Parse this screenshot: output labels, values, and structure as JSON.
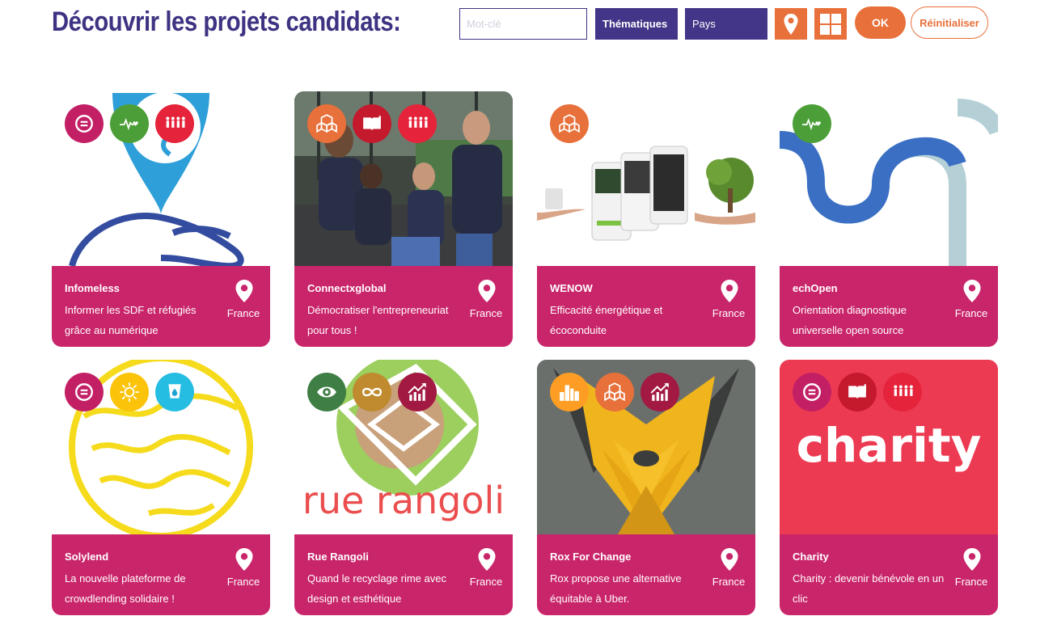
{
  "header": {
    "title": "Découvrir les projets candidats:",
    "search_placeholder": "Mot-clé",
    "themes_label": "Thématiques",
    "country_label": "Pays",
    "ok_label": "OK",
    "reset_label": "Réinitialiser"
  },
  "colors": {
    "brand_purple": "#3d3382",
    "accent_orange": "#e8703a",
    "card_footer": "#c9256a"
  },
  "cards": [
    {
      "name": "Infomeless",
      "desc": "Informer les SDF et réfugiés grâce au numérique",
      "country": "France",
      "badges": [
        "reduced-inequalities-icon",
        "good-health-icon",
        "no-poverty-icon"
      ]
    },
    {
      "name": "Connectxglobal",
      "desc": "Démocratiser l'entrepreneuriat pour tous !",
      "country": "France",
      "badges": [
        "innovation-icon",
        "education-icon",
        "no-poverty-icon"
      ]
    },
    {
      "name": "WENOW",
      "desc": "Efficacité énergétique et écoconduite",
      "country": "France",
      "badges": [
        "innovation-icon"
      ]
    },
    {
      "name": "echOpen",
      "desc": "Orientation diagnostique universelle open source",
      "country": "France",
      "badges": [
        "good-health-icon"
      ]
    },
    {
      "name": "Solylend",
      "desc": "La nouvelle plateforme de crowdlending solidaire !",
      "country": "France",
      "badges": [
        "reduced-inequalities-icon",
        "clean-energy-icon",
        "clean-water-icon"
      ]
    },
    {
      "name": "Rue Rangoli",
      "desc": "Quand le recyclage rime avec design et esthétique",
      "country": "France",
      "badges": [
        "climate-action-icon",
        "responsible-consumption-icon",
        "economic-growth-icon"
      ]
    },
    {
      "name": "Rox For Change",
      "desc": "Rox propose une alternative équitable à Uber.",
      "country": "France",
      "badges": [
        "sustainable-cities-icon",
        "innovation-icon",
        "economic-growth-icon"
      ]
    },
    {
      "name": "Charity",
      "desc": "Charity : devenir bénévole en un clic",
      "country": "France",
      "badges": [
        "reduced-inequalities-icon",
        "education-icon",
        "no-poverty-icon"
      ]
    }
  ],
  "image_texts": {
    "rangoli_logo": "rue rangoli",
    "charity_logo": "charity"
  }
}
